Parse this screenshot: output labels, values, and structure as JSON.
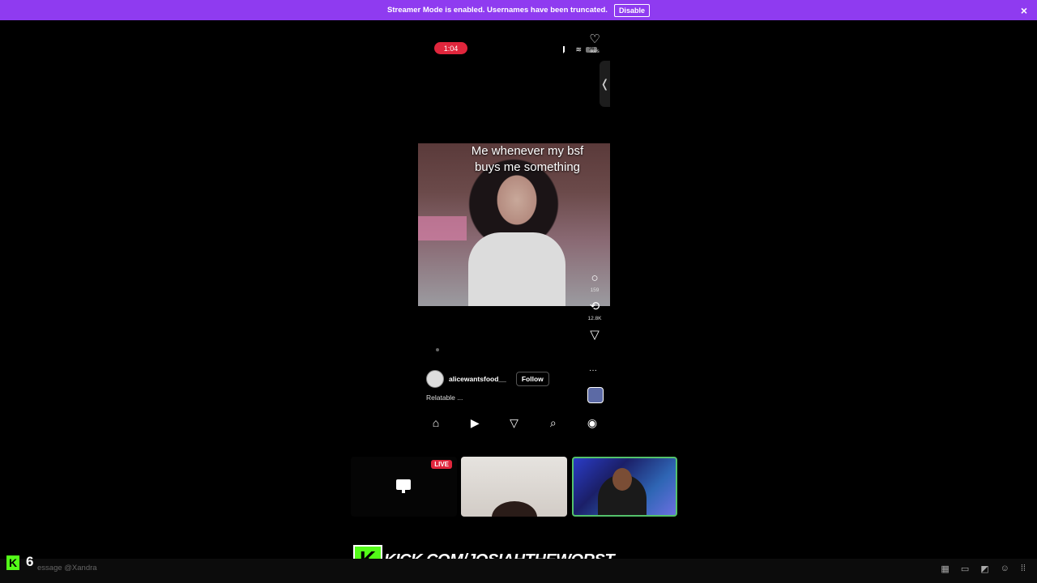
{
  "banner": {
    "message": "Streamer Mode is enabled. Usernames have been truncated.",
    "disable_label": "Disable",
    "close_icon": "×"
  },
  "phone": {
    "time": "1:04",
    "battery": "36",
    "side_tab_icon": "❬",
    "caption": "Me whenever my bsf buys me something",
    "rail": {
      "likes_label": "ikes",
      "comments_count": "159",
      "reposts_count": "12.8K"
    },
    "username": "alicewantsfood__",
    "follow_label": "Follow",
    "description": "Relatable ...",
    "more_icon": "···"
  },
  "cams": {
    "live_label": "LIVE"
  },
  "overlay": {
    "kick_letter": "K",
    "url": "KICK.COM/JOSIAHTHEWORST"
  },
  "bottom": {
    "viewer_count": "6",
    "message_placeholder": "essage @Xandra"
  },
  "colors": {
    "banner": "#8f3bf0",
    "kick_green": "#53fc18",
    "live_red": "#e0263c"
  }
}
